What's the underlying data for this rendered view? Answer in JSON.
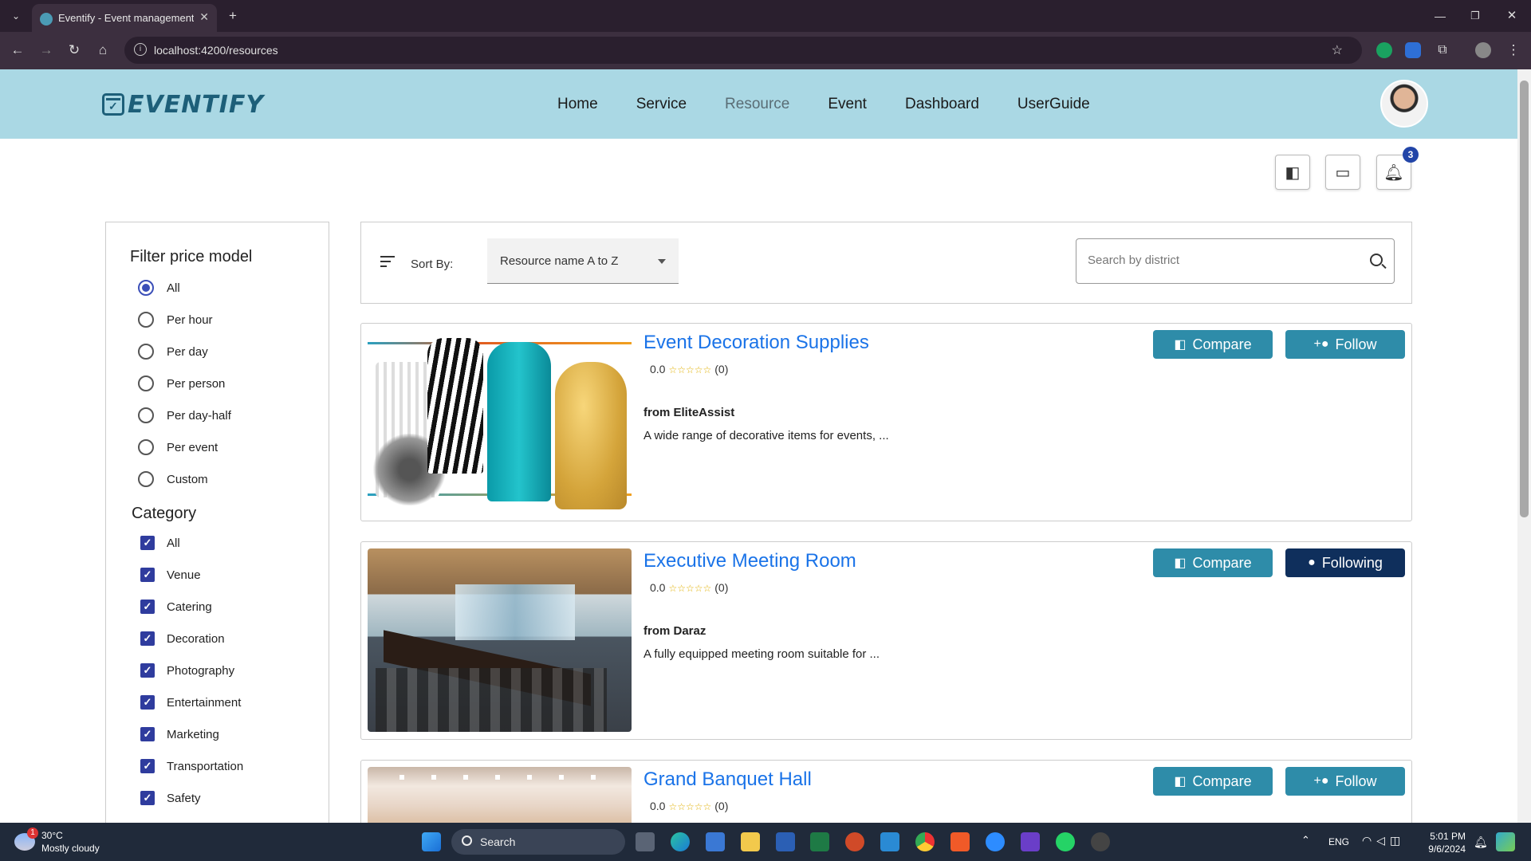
{
  "browser": {
    "tab_title": "Eventify - Event management s",
    "url": "localhost:4200/resources"
  },
  "app": {
    "logo_text": "EVENTIFY",
    "nav": [
      "Home",
      "Service",
      "Resource",
      "Event",
      "Dashboard",
      "UserGuide"
    ],
    "active_nav": "Resource",
    "notification_count": "3"
  },
  "filters": {
    "price_title": "Filter price model",
    "price_options": [
      "All",
      "Per hour",
      "Per day",
      "Per person",
      "Per day-half",
      "Per event",
      "Custom"
    ],
    "price_selected": "All",
    "category_title": "Category",
    "categories": [
      "All",
      "Venue",
      "Catering",
      "Decoration",
      "Photography",
      "Entertainment",
      "Marketing",
      "Transportation",
      "Safety"
    ]
  },
  "sort": {
    "label": "Sort By:",
    "value": "Resource name A to Z",
    "search_placeholder": "Search by district"
  },
  "resources": [
    {
      "title": "Event Decoration Supplies",
      "rating": "0.0",
      "reviews": "(0)",
      "from": "from EliteAssist",
      "desc": "A wide range of decorative items for events, ...",
      "compare": "Compare",
      "follow": "Follow",
      "following": false
    },
    {
      "title": "Executive Meeting Room",
      "rating": "0.0",
      "reviews": "(0)",
      "from": "from Daraz",
      "desc": "A fully equipped meeting room suitable for ...",
      "compare": "Compare",
      "follow": "Following",
      "following": true
    },
    {
      "title": "Grand Banquet Hall",
      "rating": "0.0",
      "reviews": "(0)",
      "from": "",
      "desc": "",
      "compare": "Compare",
      "follow": "Follow",
      "following": false
    }
  ],
  "taskbar": {
    "weather_temp": "30°C",
    "weather_desc": "Mostly cloudy",
    "weather_badge": "1",
    "search": "Search",
    "lang": "ENG",
    "time": "5:01 PM",
    "date": "9/6/2024"
  }
}
